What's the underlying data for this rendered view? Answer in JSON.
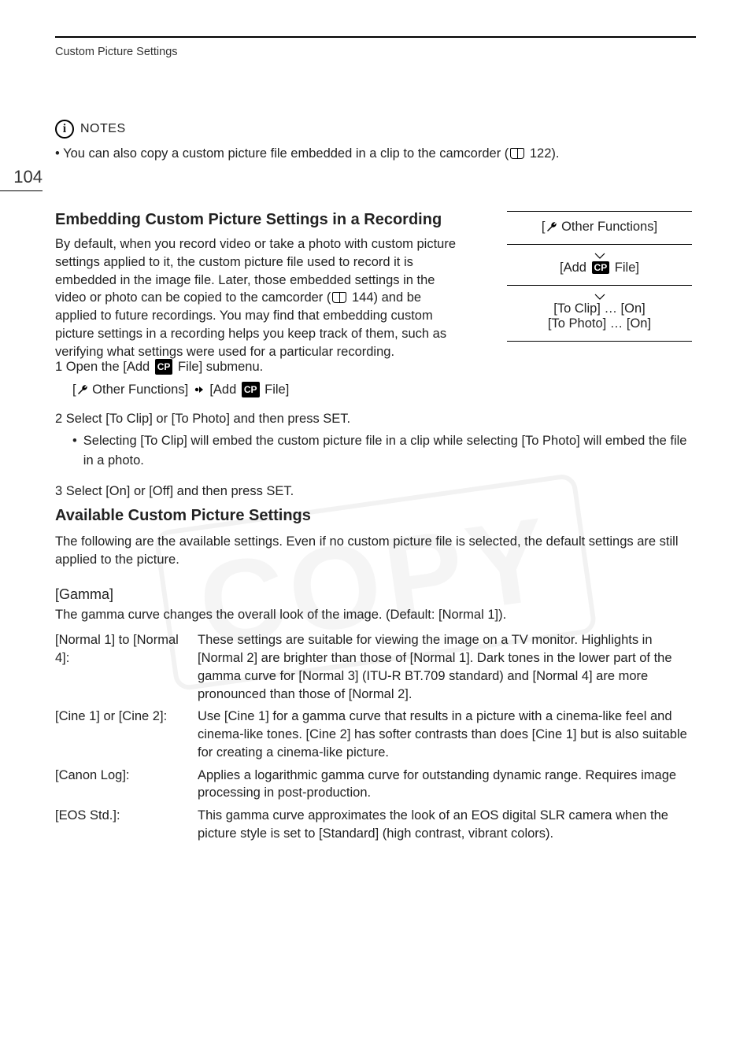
{
  "header": {
    "section_label": "Custom Picture Settings",
    "page_number": "104"
  },
  "notes": {
    "label": "NOTES",
    "bullet_prefix": "•",
    "line_pre": "You can also copy a custom picture file embedded in a clip to the camcorder (",
    "line_ref": "122",
    "line_post": ")."
  },
  "embed": {
    "heading": "Embedding Custom Picture Settings in a Recording",
    "para_pre": "By default, when you record video or take a photo with custom picture settings applied to it, the custom picture file used to record it is embedded in the image file. Later, those embedded settings in the video or photo can be copied to the camcorder (",
    "para_ref": "144",
    "para_post": ") and be applied to future recordings. You may find that embedding custom picture settings in a recording helps you keep track of them, such as verifying what settings were used for a particular recording."
  },
  "menu": {
    "row1_pre": "[",
    "row1_label": " Other Functions]",
    "row2_pre": "[Add ",
    "row2_post": " File]",
    "row3a": "[To Clip] … [On]",
    "row3b": "[To Photo] … [On]"
  },
  "steps": {
    "s1_pre": "1 Open the [Add ",
    "s1_post": " File] submenu.",
    "s1_sub_pre": "[",
    "s1_sub_mid1": " Other Functions] ",
    "s1_sub_mid2": " [Add ",
    "s1_sub_post": " File]",
    "s2": "2 Select [To Clip] or [To Photo] and then press SET.",
    "s2_bullet": "Selecting [To Clip] will embed the custom picture file in a clip while selecting [To Photo] will embed the file in a photo.",
    "s3": "3 Select [On] or [Off] and then press SET."
  },
  "avail": {
    "heading": "Available Custom Picture Settings",
    "intro": "The following are the available settings. Even if no custom picture file is selected, the default settings are still applied to the picture.",
    "gamma_head": "[Gamma]",
    "gamma_body": "The gamma curve changes the overall look of the image. (Default: [Normal 1]).",
    "defs": [
      {
        "term": "[Normal 1] to [Normal 4]:",
        "desc": "These settings are suitable for viewing the image on a TV monitor. Highlights in [Normal 2] are brighter than those of [Normal 1]. Dark tones in the lower part of the gamma curve for [Normal 3] (ITU-R BT.709 standard) and [Normal 4] are more pronounced than those of [Normal 2]."
      },
      {
        "term": "[Cine 1] or [Cine 2]:",
        "desc": "Use [Cine 1] for a gamma curve that results in a picture with a cinema-like feel and cinema-like tones. [Cine 2] has softer contrasts than does [Cine 1] but is also suitable for creating a cinema-like picture."
      },
      {
        "term": "[Canon Log]:",
        "desc": "Applies a logarithmic gamma curve for outstanding dynamic range. Requires image processing in post-production."
      },
      {
        "term": "[EOS Std.]:",
        "desc": "This gamma curve approximates the look of an EOS digital SLR camera when the picture style is set to [Standard] (high contrast, vibrant colors)."
      }
    ]
  }
}
